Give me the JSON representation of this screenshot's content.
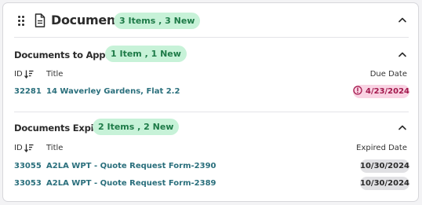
{
  "panel": {
    "title": "Documents",
    "badge": "3 Items , 3 New",
    "icons": {
      "drag": "drag-handle-icon",
      "document": "document-icon",
      "collapse": "chevron-up-icon"
    }
  },
  "sections": [
    {
      "title": "Documents to Approve",
      "badge": "1 Item , 1 New",
      "columns": {
        "id": "ID",
        "title": "Title",
        "date": "Due Date"
      },
      "rows": [
        {
          "id": "32281",
          "title": "14 Waverley Gardens, Flat 2.2",
          "date": "4/23/2024",
          "status": "overdue"
        }
      ]
    },
    {
      "title": "Documents Expired",
      "badge": "2 Items , 2 New",
      "columns": {
        "id": "ID",
        "title": "Title",
        "date": "Expired Date"
      },
      "rows": [
        {
          "id": "33055",
          "title": "A2LA WPT - Quote Request Form-2390",
          "date": "10/30/2024",
          "status": "expired"
        },
        {
          "id": "33053",
          "title": "A2LA WPT - Quote Request Form-2389",
          "date": "10/30/2024",
          "status": "expired"
        }
      ]
    }
  ],
  "colors": {
    "badge_bg": "#c7f2d8",
    "badge_text": "#1d7a47",
    "link": "#2a6f7c",
    "overdue_bg": "#f9d3e3",
    "overdue_text": "#a3194d",
    "date_bg": "#e1e1e4"
  }
}
